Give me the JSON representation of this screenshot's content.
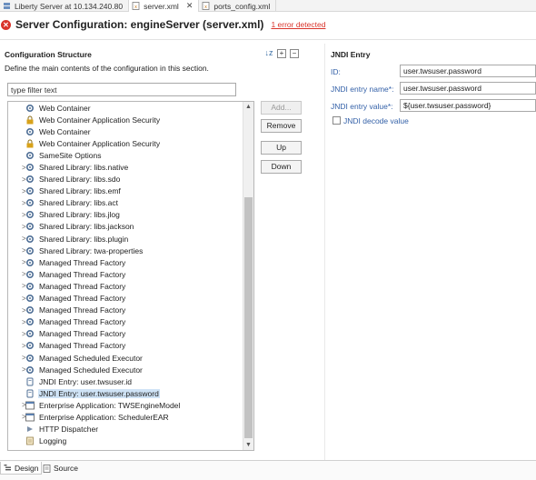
{
  "tabs": [
    {
      "label": "Liberty Server at 10.134.240.80",
      "icon": "server-icon",
      "active": false
    },
    {
      "label": "server.xml",
      "icon": "xml-file-icon",
      "active": true,
      "close": "✕"
    },
    {
      "label": "ports_config.xml",
      "icon": "xml-file-icon",
      "active": false
    }
  ],
  "header": {
    "title": "Server Configuration: engineServer (server.xml)",
    "error_link": "1 error detected",
    "error_icon": "error-icon",
    "error_glyph": "✕"
  },
  "config": {
    "title": "Configuration Structure",
    "description": "Define the main contents of the configuration in this section.",
    "filter_placeholder": "type filter text",
    "tools": {
      "sort": "↓z",
      "add": "+",
      "remove": "−"
    }
  },
  "tree_items": [
    {
      "label": "Web Container",
      "icon": "gear-icon",
      "expand": ""
    },
    {
      "label": "Web Container Application Security",
      "icon": "lock-icon",
      "expand": ""
    },
    {
      "label": "Web Container",
      "icon": "gear-icon",
      "expand": ""
    },
    {
      "label": "Web Container Application Security",
      "icon": "lock-icon",
      "expand": ""
    },
    {
      "label": "SameSite Options",
      "icon": "gear-icon",
      "expand": ""
    },
    {
      "label": "Shared Library: libs.native",
      "icon": "gear-icon",
      "expand": ">"
    },
    {
      "label": "Shared Library: libs.sdo",
      "icon": "gear-icon",
      "expand": ">"
    },
    {
      "label": "Shared Library: libs.emf",
      "icon": "gear-icon",
      "expand": ">"
    },
    {
      "label": "Shared Library: libs.act",
      "icon": "gear-icon",
      "expand": ">"
    },
    {
      "label": "Shared Library: libs.jlog",
      "icon": "gear-icon",
      "expand": ">"
    },
    {
      "label": "Shared Library: libs.jackson",
      "icon": "gear-icon",
      "expand": ">"
    },
    {
      "label": "Shared Library: libs.plugin",
      "icon": "gear-icon",
      "expand": ">"
    },
    {
      "label": "Shared Library: twa-properties",
      "icon": "gear-icon",
      "expand": ">"
    },
    {
      "label": "Managed Thread Factory",
      "icon": "gear-icon",
      "expand": ">"
    },
    {
      "label": "Managed Thread Factory",
      "icon": "gear-icon",
      "expand": ">"
    },
    {
      "label": "Managed Thread Factory",
      "icon": "gear-icon",
      "expand": ">"
    },
    {
      "label": "Managed Thread Factory",
      "icon": "gear-icon",
      "expand": ">"
    },
    {
      "label": "Managed Thread Factory",
      "icon": "gear-icon",
      "expand": ">"
    },
    {
      "label": "Managed Thread Factory",
      "icon": "gear-icon",
      "expand": ">"
    },
    {
      "label": "Managed Thread Factory",
      "icon": "gear-icon",
      "expand": ">"
    },
    {
      "label": "Managed Thread Factory",
      "icon": "gear-icon",
      "expand": ">"
    },
    {
      "label": "Managed Scheduled Executor",
      "icon": "gear-icon",
      "expand": ">"
    },
    {
      "label": "Managed Scheduled Executor",
      "icon": "gear-icon",
      "expand": ">"
    },
    {
      "label": "JNDI Entry: user.twsuser.id",
      "icon": "jndi-icon",
      "expand": ""
    },
    {
      "label": "JNDI Entry: user.twsuser.password",
      "icon": "jndi-icon",
      "expand": "",
      "selected": true
    },
    {
      "label": "Enterprise Application: TWSEngineModel",
      "icon": "application-icon",
      "expand": ">"
    },
    {
      "label": "Enterprise Application: SchedulerEAR",
      "icon": "application-icon",
      "expand": ">"
    },
    {
      "label": "HTTP Dispatcher",
      "icon": "dispatcher-icon",
      "expand": ""
    },
    {
      "label": "Logging",
      "icon": "logging-icon",
      "expand": ""
    }
  ],
  "buttons": {
    "add": "Add...",
    "remove": "Remove",
    "up": "Up",
    "down": "Down"
  },
  "jndi": {
    "title": "JNDI Entry",
    "id_label": "ID:",
    "id_value": "user.twsuser.password",
    "name_label": "JNDI entry name*:",
    "name_value": "user.twsuser.password",
    "value_label": "JNDI entry value*:",
    "value_value": "${user.twsuser.password}",
    "decode_label": "JNDI decode value",
    "decode_checked": false
  },
  "bottom_tabs": [
    {
      "label": "Design",
      "active": true
    },
    {
      "label": "Source",
      "active": false
    }
  ],
  "scrollbar": {
    "up": "▲",
    "down": "▼"
  },
  "colors": {
    "accent_link": "#3461a8",
    "error": "#d9342b",
    "selection": "#cfe3f6"
  }
}
